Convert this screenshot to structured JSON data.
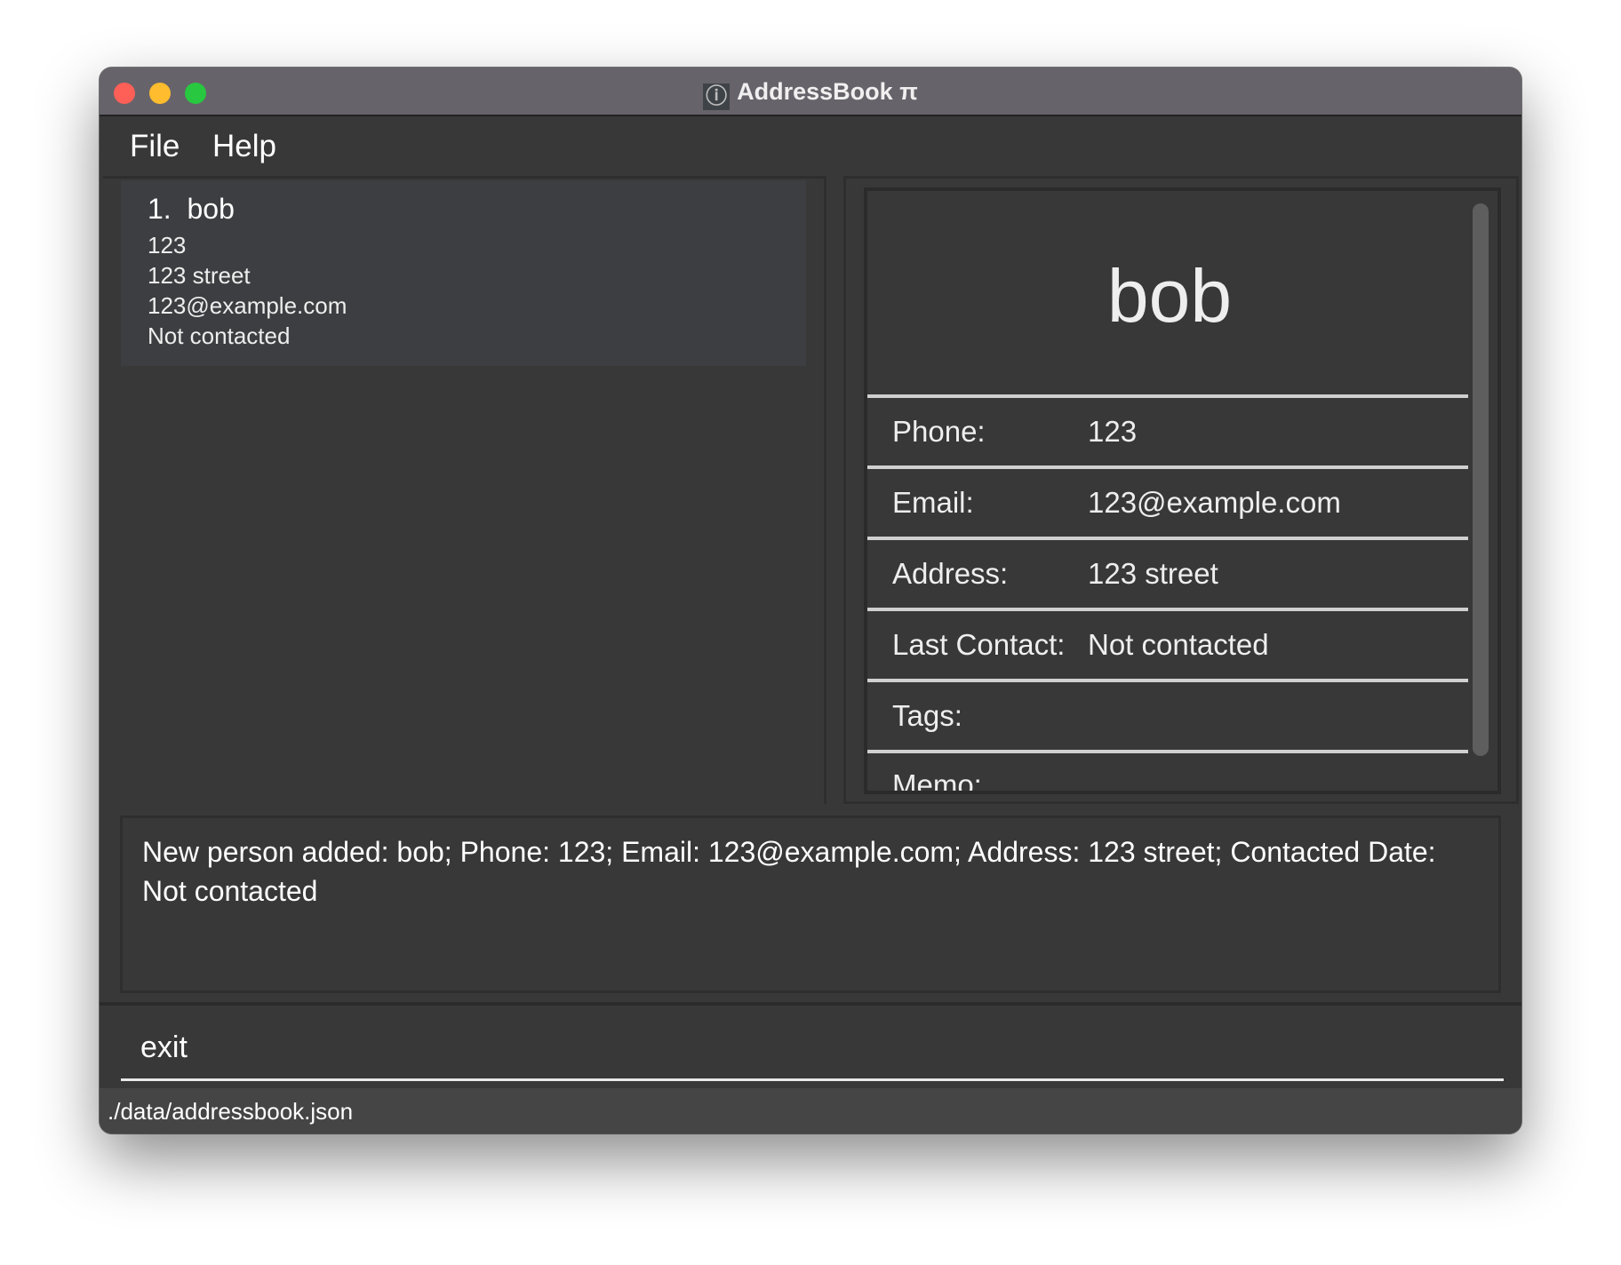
{
  "window": {
    "title": "AddressBook π",
    "app_icon": "pi-icon",
    "traffic_lights": {
      "close": "#fe5f57",
      "minimize": "#febc2e",
      "maximize": "#28c840"
    }
  },
  "menu": {
    "items": [
      "File",
      "Help"
    ]
  },
  "person_list": [
    {
      "index": "1.",
      "name": "bob",
      "phone": "123",
      "address": "123 street",
      "email": "123@example.com",
      "last_contact": "Not contacted"
    }
  ],
  "detail": {
    "name": "bob",
    "fields": [
      {
        "label": "Phone:",
        "value": "123"
      },
      {
        "label": "Email:",
        "value": "123@example.com"
      },
      {
        "label": "Address:",
        "value": "123 street"
      },
      {
        "label": "Last Contact:",
        "value": "Not contacted"
      },
      {
        "label": "Tags:",
        "value": ""
      },
      {
        "label": "Memo:",
        "value": ""
      }
    ]
  },
  "result": {
    "text": "New person added: bob; Phone: 123; Email: 123@example.com; Address: 123 street; Contacted Date: Not contacted"
  },
  "command": {
    "value": "exit"
  },
  "status": {
    "path": "./data/addressbook.json"
  }
}
